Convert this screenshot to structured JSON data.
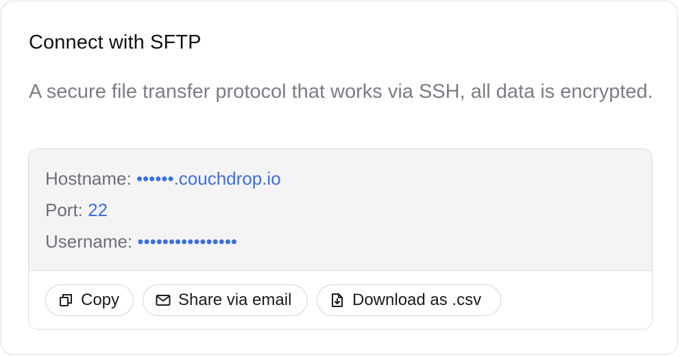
{
  "card": {
    "title": "Connect with SFTP",
    "description": "A secure file transfer protocol that works via SSH, all data is encrypted."
  },
  "details": {
    "hostname": {
      "label": "Hostname: ",
      "value": "••••••.couchdrop.io"
    },
    "port": {
      "label": "Port: ",
      "value": "22"
    },
    "username": {
      "label": "Username: ",
      "value": "••••••••••••••••"
    }
  },
  "actions": {
    "copy": {
      "label": "Copy",
      "icon": "copy-icon"
    },
    "share": {
      "label": "Share via email",
      "icon": "mail-icon"
    },
    "download": {
      "label": "Download as .csv",
      "icon": "download-file-icon"
    }
  },
  "colors": {
    "accent": "#3b6fe0",
    "muted_text": "#7a7d85",
    "panel_bg": "#f4f4f5",
    "border": "#dcdcdf"
  }
}
